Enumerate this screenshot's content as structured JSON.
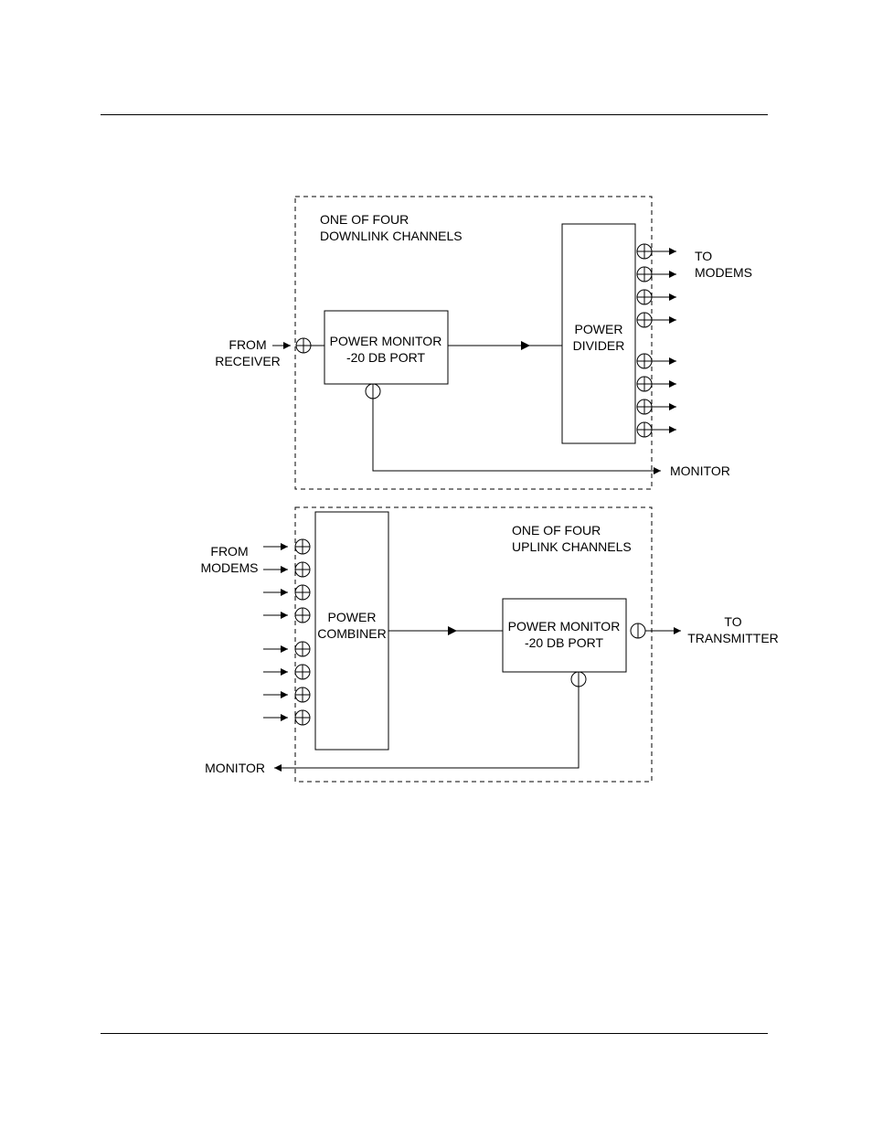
{
  "downlink": {
    "note_l1": "ONE OF FOUR",
    "note_l2": "DOWNLINK CHANNELS",
    "left_label_l1": "FROM",
    "left_label_l2": "RECEIVER",
    "pm_l1": "POWER MONITOR",
    "pm_l2": "-20 DB PORT",
    "divider_l1": "POWER",
    "divider_l2": "DIVIDER",
    "right_label_l1": "TO",
    "right_label_l2": "MODEMS",
    "monitor": "MONITOR"
  },
  "uplink": {
    "note_l1": "ONE OF FOUR",
    "note_l2": "UPLINK CHANNELS",
    "left_label_l1": "FROM",
    "left_label_l2": "MODEMS",
    "combiner_l1": "POWER",
    "combiner_l2": "COMBINER",
    "pm_l1": "POWER MONITOR",
    "pm_l2": "-20 DB PORT",
    "right_label_l1": "TO",
    "right_label_l2": "TRANSMITTER",
    "monitor": "MONITOR"
  }
}
